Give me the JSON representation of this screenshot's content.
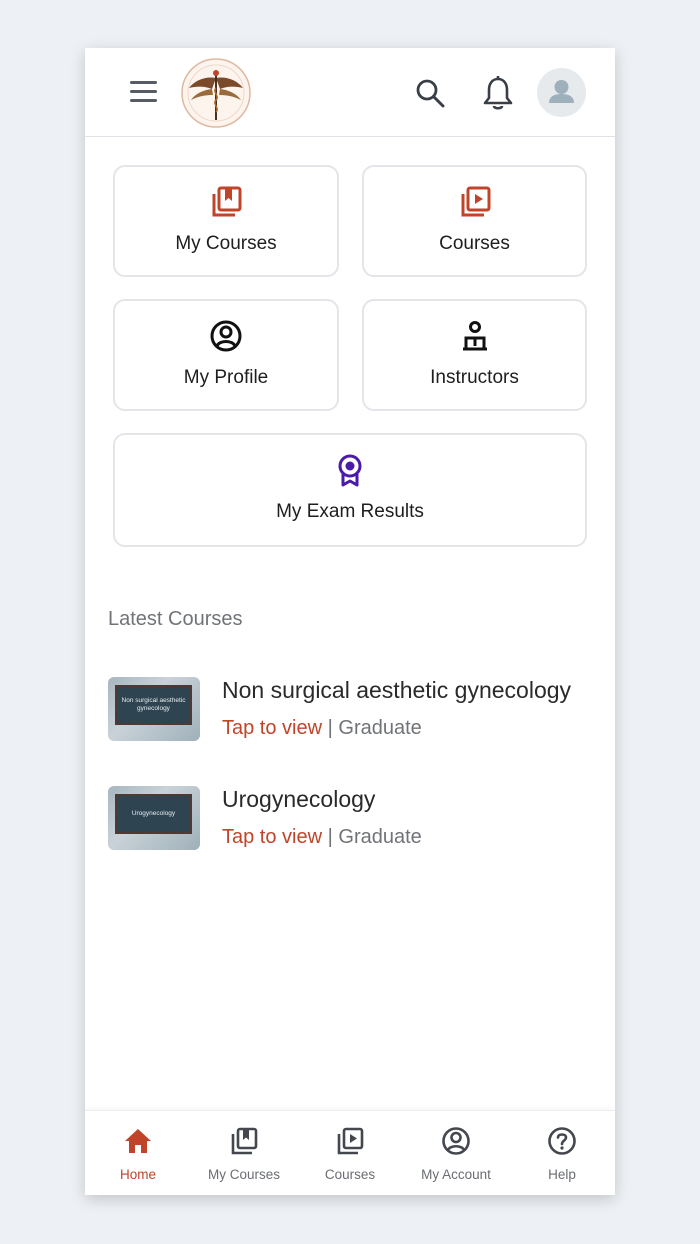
{
  "colors": {
    "accent": "#c0442a",
    "purple": "#4a1aa8",
    "text": "#1e1e1e",
    "muted": "#707378"
  },
  "header": {
    "menu_icon": "hamburger-icon",
    "logo_icon": "winged-caduceus-logo",
    "search_icon": "search-icon",
    "bell_icon": "bell-icon",
    "avatar_icon": "user-avatar-icon"
  },
  "tiles": [
    {
      "label": "My Courses",
      "icon": "bookmark-book-icon"
    },
    {
      "label": "Courses",
      "icon": "video-library-icon"
    },
    {
      "label": "My Profile",
      "icon": "user-circle-icon"
    },
    {
      "label": "Instructors",
      "icon": "instructor-icon"
    },
    {
      "label": "My Exam Results",
      "icon": "award-ribbon-icon"
    }
  ],
  "latest": {
    "title": "Latest Courses",
    "items": [
      {
        "title": "Non surgical aesthetic gynecology",
        "thumb_text": "Non surgical aesthetic gynecology",
        "action": "Tap to view",
        "separator": "|",
        "level": "Graduate"
      },
      {
        "title": "Urogynecology",
        "thumb_text": "Urogynecology",
        "action": "Tap to view",
        "separator": "|",
        "level": "Graduate"
      }
    ]
  },
  "bottom_nav": [
    {
      "label": "Home",
      "icon": "home-icon",
      "active": true
    },
    {
      "label": "My Courses",
      "icon": "bookmark-book-icon"
    },
    {
      "label": "Courses",
      "icon": "video-library-icon"
    },
    {
      "label": "My Account",
      "icon": "user-circle-icon"
    },
    {
      "label": "Help",
      "icon": "help-circle-icon"
    }
  ]
}
